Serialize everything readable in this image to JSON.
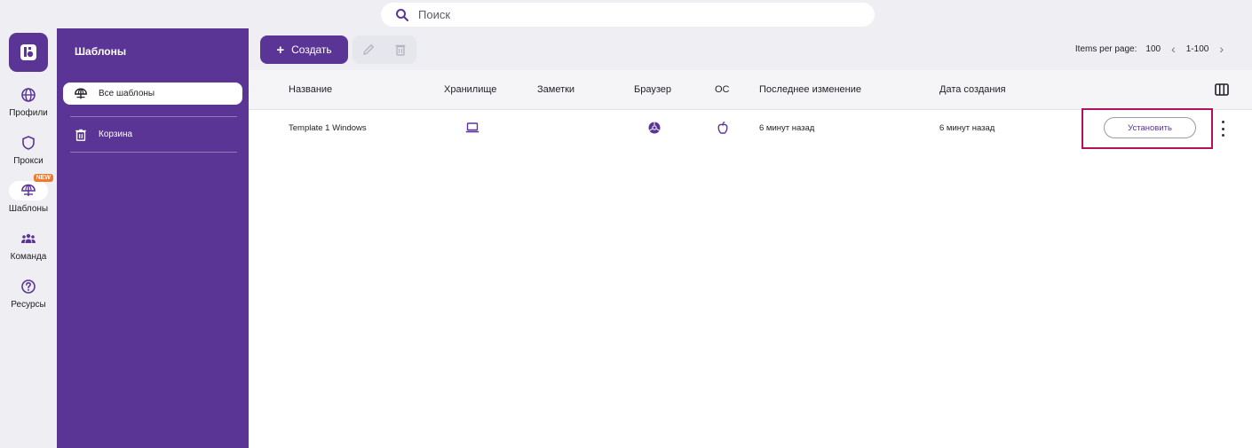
{
  "search": {
    "placeholder": "Поиск"
  },
  "rail": {
    "items": [
      {
        "label": "Профили",
        "icon": "globe-icon"
      },
      {
        "label": "Прокси",
        "icon": "shield-icon"
      },
      {
        "label": "Шаблоны",
        "icon": "umbrella-icon",
        "badge": "NEW",
        "active": true
      },
      {
        "label": "Команда",
        "icon": "team-icon"
      },
      {
        "label": "Ресурсы",
        "icon": "help-icon"
      }
    ]
  },
  "sidebar": {
    "title": "Шаблоны",
    "items": [
      {
        "label": "Все шаблоны",
        "icon": "umbrella-icon",
        "active": true
      },
      {
        "label": "Корзина",
        "icon": "trash-icon"
      }
    ]
  },
  "toolbar": {
    "create_label": "Создать",
    "items_per_page_label": "Items per page:",
    "items_per_page": "100",
    "range": "1-100"
  },
  "table": {
    "headers": [
      "Название",
      "Хранилище",
      "Заметки",
      "Браузер",
      "ОС",
      "Последнее изменение",
      "Дата создания"
    ],
    "rows": [
      {
        "name": "Template 1 Windows",
        "storage_icon": "laptop-icon",
        "notes": "",
        "browser_icon": "chromium-icon",
        "os_icon": "apple-icon",
        "modified": "6 минут назад",
        "created": "6 минут назад",
        "action_label": "Установить"
      }
    ]
  },
  "colors": {
    "brand": "#5b3596",
    "highlight": "#b0135e",
    "badge": "#f07a2b"
  }
}
